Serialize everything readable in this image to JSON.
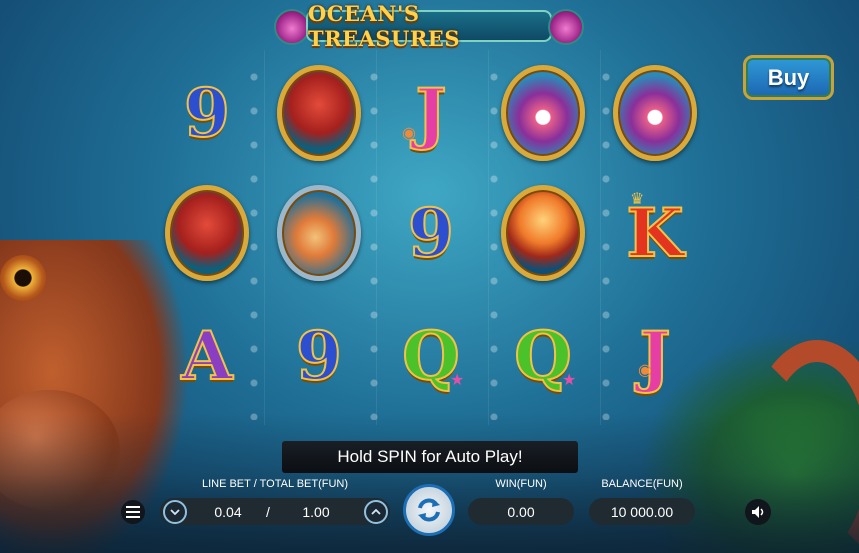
{
  "title": "OCEAN'S TREASURES",
  "buy_label": "Buy",
  "reels": [
    [
      "9",
      "octopus",
      "A"
    ],
    [
      "octopus",
      "lionfish",
      "9"
    ],
    [
      "J",
      "9",
      "Q"
    ],
    [
      "oyster",
      "jellyfish",
      "Q"
    ],
    [
      "oyster",
      "K",
      "J"
    ]
  ],
  "hold_message": "Hold SPIN for Auto Play!",
  "controls": {
    "bet_label": "LINE BET / TOTAL BET(FUN)",
    "line_bet": "0.04",
    "bet_separator": "/",
    "total_bet": "1.00",
    "win_label": "WIN(FUN)",
    "win_value": "0.00",
    "balance_label": "BALANCE(FUN)",
    "balance_value": "10 000.00"
  },
  "icons": {
    "menu": "menu-icon",
    "decrease_bet": "chevron-down-icon",
    "increase_bet": "chevron-up-icon",
    "spin": "spin-arrows-icon",
    "sound": "speaker-icon"
  },
  "colors": {
    "gold": "#f3c245",
    "spin_ring": "#1c6fb6",
    "buy_blue": "#2f9ad8"
  }
}
